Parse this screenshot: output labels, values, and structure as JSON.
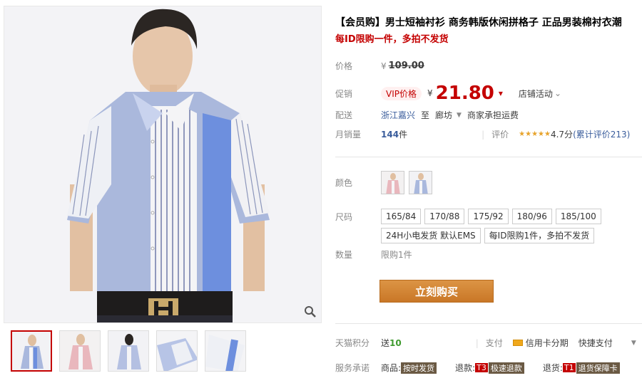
{
  "product": {
    "title": "【会员购】男士短袖衬衫 商务韩版休闲拼格子 正品男装棉衬衣潮",
    "subtitle": "每ID限购一件，多拍不发货"
  },
  "price": {
    "label": "价格",
    "currency": "¥",
    "original": "109.00"
  },
  "promo": {
    "label": "促销",
    "vip_label": "VIP价格",
    "currency": "¥",
    "price": "21.80",
    "shop_activity": "店铺活动"
  },
  "shipping": {
    "label": "配送",
    "from": "浙江嘉兴",
    "to_word": "至",
    "to": "廊坊",
    "fee": "商家承担运费"
  },
  "sales": {
    "label": "月销量",
    "count": "144",
    "unit": "件",
    "rating_label": "评价",
    "rating": "4.7分",
    "reviews_label": "(累计评价213)"
  },
  "color": {
    "label": "颜色"
  },
  "size": {
    "label": "尺码",
    "options": [
      "165/84",
      "170/88",
      "175/92",
      "180/96",
      "185/100"
    ],
    "notes": [
      "24H小电发货 默认EMS",
      "每ID限购1件，多拍不发货"
    ]
  },
  "quantity": {
    "label": "数量",
    "limit": "限购1件"
  },
  "buy_button": "立刻购买",
  "points": {
    "label": "天猫积分",
    "prefix": "送",
    "value": "10",
    "pay_label": "支付",
    "credit": "信用卡分期",
    "express": "快捷支付"
  },
  "service": {
    "label": "服务承诺",
    "goods": "商品:",
    "goods_tag": "按时发货",
    "refund": "退款:",
    "refund_code": "T3",
    "refund_tag": "极速退款",
    "return": "退货:",
    "return_code": "T1",
    "return_tag": "退货保障卡"
  },
  "colors": {
    "accent": "#c40000",
    "buy_button": "#d7862f"
  }
}
